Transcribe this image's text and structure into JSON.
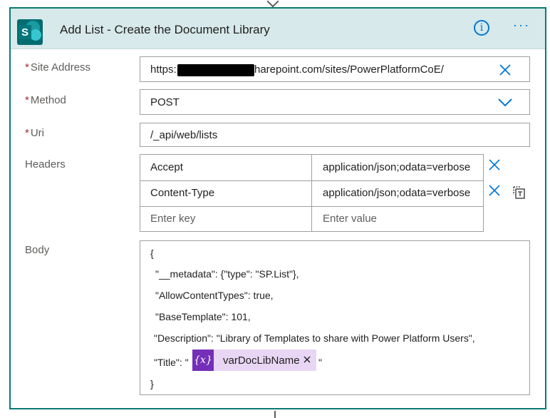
{
  "action": {
    "title": "Add List - Create the Document Library",
    "info_icon": "i",
    "more_icon": "···"
  },
  "fields": {
    "site_address": {
      "label": "Site Address",
      "required_mark": "*",
      "value_prefix": "https:",
      "value_suffix": "harepoint.com/sites/PowerPlatformCoE/"
    },
    "method": {
      "label": "Method",
      "required_mark": "*",
      "value": "POST"
    },
    "uri": {
      "label": "Uri",
      "required_mark": "*",
      "value": "/_api/web/lists"
    },
    "headers": {
      "label": "Headers",
      "rows": [
        {
          "key": "Accept",
          "value": "application/json;odata=verbose"
        },
        {
          "key": "Content-Type",
          "value": "application/json;odata=verbose"
        }
      ],
      "key_placeholder": "Enter key",
      "value_placeholder": "Enter value"
    },
    "body": {
      "label": "Body",
      "lines": [
        "{",
        "\"__metadata\": {\"type\": \"SP.List\"},",
        "\"AllowContentTypes\": true,",
        "\"BaseTemplate\": 101,",
        "\"Description\": \"Library of Templates to share with Power Platform Users\",",
        "\"Title\": \"",
        "\"",
        "}"
      ],
      "token": {
        "badge": "{x}",
        "name": "varDocLibName",
        "remove": "×"
      }
    }
  },
  "colors": {
    "header_bg": "#d7e9ea",
    "border": "#0b7a75",
    "accent": "#0078d4",
    "required": "#a4262c",
    "token_bg": "#e8d6f4",
    "token_badge": "#742eb8"
  },
  "icons": [
    "sharepoint-logo-icon",
    "info-icon",
    "more-icon",
    "clear-icon",
    "chevron-down-icon",
    "remove-row-icon",
    "copy-icon",
    "variable-icon"
  ]
}
